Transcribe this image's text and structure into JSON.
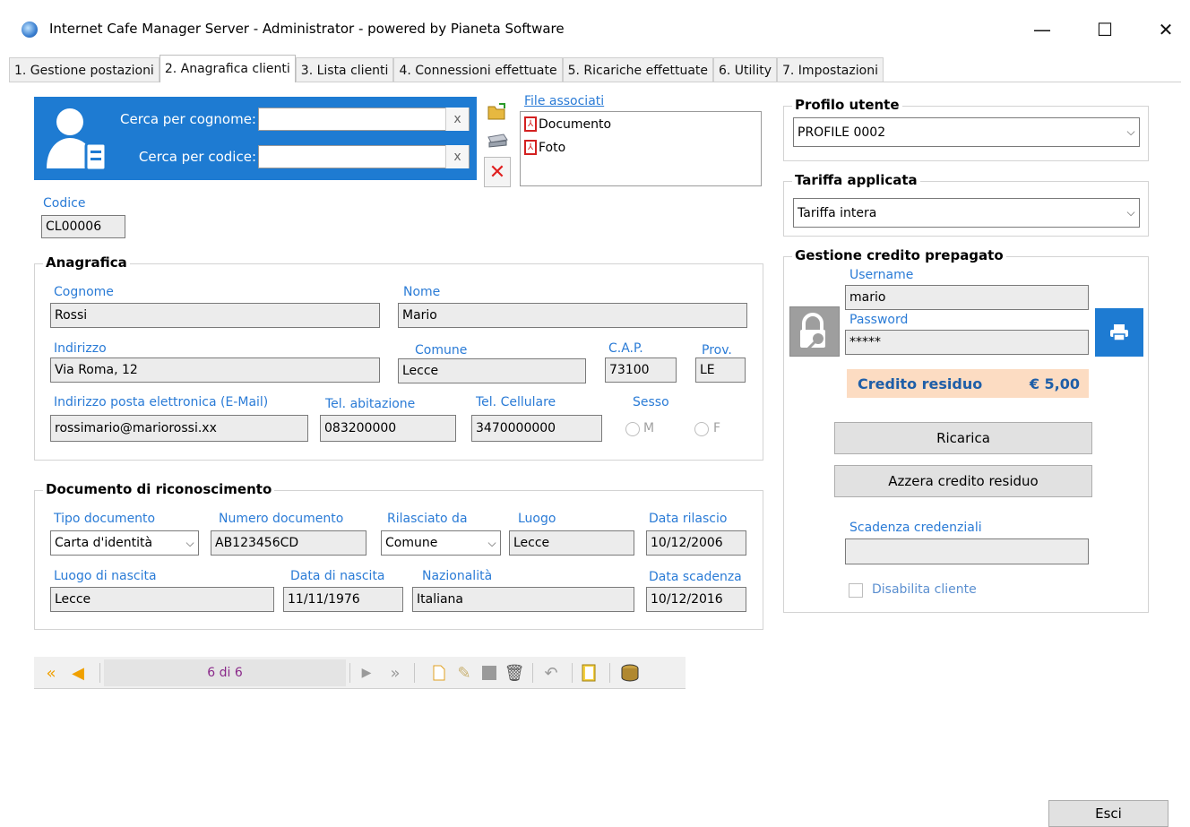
{
  "window": {
    "title": "Internet Cafe Manager Server - Administrator - powered by Pianeta Software",
    "minimize": "—",
    "maximize": "☐",
    "close": "✕"
  },
  "tabs": [
    {
      "label": "1. Gestione postazioni"
    },
    {
      "label": "2. Anagrafica clienti"
    },
    {
      "label": "3. Lista clienti"
    },
    {
      "label": "4. Connessioni effettuate"
    },
    {
      "label": "5. Ricariche effettuate"
    },
    {
      "label": "6. Utility"
    },
    {
      "label": "7. Impostazioni"
    }
  ],
  "search": {
    "by_surname_label": "Cerca per cognome:",
    "by_surname_value": "",
    "by_code_label": "Cerca per codice:",
    "by_code_value": "",
    "clear_symbol": "x"
  },
  "files": {
    "label": "File associati",
    "items": [
      {
        "name": "Documento"
      },
      {
        "name": "Foto"
      }
    ]
  },
  "codice": {
    "label": "Codice",
    "value": "CL00006"
  },
  "anagrafica": {
    "title": "Anagrafica",
    "cognome": {
      "label": "Cognome",
      "value": "Rossi"
    },
    "nome": {
      "label": "Nome",
      "value": "Mario"
    },
    "indirizzo": {
      "label": "Indirizzo",
      "value": "Via Roma, 12"
    },
    "comune": {
      "label": "Comune",
      "value": "Lecce"
    },
    "cap": {
      "label": "C.A.P.",
      "value": "73100"
    },
    "prov": {
      "label": "Prov.",
      "value": "LE"
    },
    "email": {
      "label": "Indirizzo posta elettronica (E-Mail)",
      "value": "rossimario@mariorossi.xx"
    },
    "tel_abitazione": {
      "label": "Tel. abitazione",
      "value": "083200000"
    },
    "tel_cellulare": {
      "label": "Tel. Cellulare",
      "value": "3470000000"
    },
    "sesso": {
      "label": "Sesso",
      "m": "M",
      "f": "F"
    }
  },
  "documento": {
    "title": "Documento di riconoscimento",
    "tipo": {
      "label": "Tipo documento",
      "value": "Carta d'identità"
    },
    "numero": {
      "label": "Numero documento",
      "value": "AB123456CD"
    },
    "rilasciato": {
      "label": "Rilasciato da",
      "value": "Comune"
    },
    "luogo": {
      "label": "Luogo",
      "value": "Lecce"
    },
    "data_rilascio": {
      "label": "Data rilascio",
      "value": "10/12/2006"
    },
    "luogo_nascita": {
      "label": "Luogo di nascita",
      "value": "Lecce"
    },
    "data_nascita": {
      "label": "Data di nascita",
      "value": "11/11/1976"
    },
    "nazionalita": {
      "label": "Nazionalità",
      "value": "Italiana"
    },
    "data_scadenza": {
      "label": "Data scadenza",
      "value": "10/12/2016"
    }
  },
  "profilo": {
    "title": "Profilo utente",
    "value": "PROFILE 0002"
  },
  "tariffa": {
    "title": "Tariffa applicata",
    "value": "Tariffa intera"
  },
  "credito": {
    "title": "Gestione credito prepagato",
    "username_label": "Username",
    "username": "mario",
    "password_label": "Password",
    "password": "*****",
    "residuo_label": "Credito residuo",
    "residuo_value": "€ 5,00",
    "ricarica_btn": "Ricarica",
    "azzera_btn": "Azzera credito residuo",
    "scadenza_label": "Scadenza credenziali",
    "scadenza_value": "",
    "disabilita_label": "Disabilita cliente"
  },
  "navigator": {
    "position": "6 di 6"
  },
  "esci_btn": "Esci"
}
